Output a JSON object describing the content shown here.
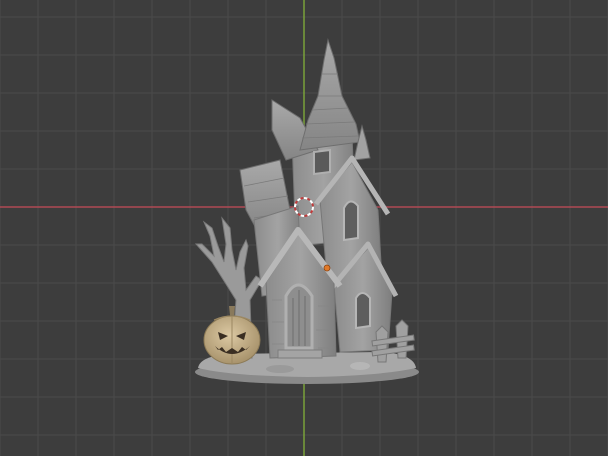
{
  "viewport": {
    "name": "3D Viewport",
    "background": "#3d3d3d",
    "grid_color": "#4a4a4a",
    "x_axis_color": "#b04a55",
    "y_axis_color": "#7aa23a"
  },
  "scene": {
    "object": "haunted-house-model",
    "model_color": "#9c9c9c",
    "pumpkin_color": "#c8b590",
    "origin_marker_color": "#e07a2a",
    "cursor_colors": [
      "#c03a3a",
      "#ffffff"
    ]
  }
}
